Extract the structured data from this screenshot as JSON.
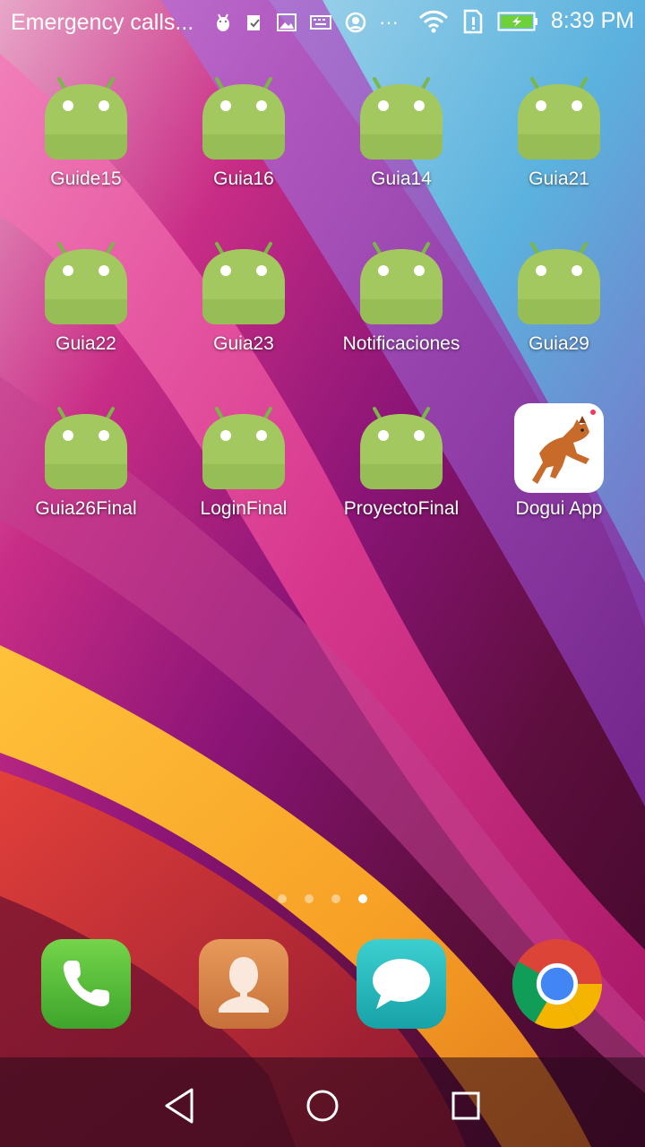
{
  "status_bar": {
    "carrier": "Emergency calls...",
    "time": "8:39 PM",
    "icons": [
      "android-debug-icon",
      "clipboard-check-icon",
      "gallery-icon",
      "keyboard-icon",
      "vpn-icon",
      "more-icon",
      "wifi-icon",
      "sim-alert-icon",
      "battery-charging-icon"
    ]
  },
  "apps": [
    {
      "label": "Guide15",
      "icon": "android-icon"
    },
    {
      "label": "Guia16",
      "icon": "android-icon"
    },
    {
      "label": "Guia14",
      "icon": "android-icon"
    },
    {
      "label": "Guia21",
      "icon": "android-icon"
    },
    {
      "label": "Guia22",
      "icon": "android-icon"
    },
    {
      "label": "Guia23",
      "icon": "android-icon"
    },
    {
      "label": "Notificaciones",
      "icon": "android-icon"
    },
    {
      "label": "Guia29",
      "icon": "android-icon"
    },
    {
      "label": "Guia26Final",
      "icon": "android-icon"
    },
    {
      "label": "LoginFinal",
      "icon": "android-icon"
    },
    {
      "label": "ProyectoFinal",
      "icon": "android-icon"
    },
    {
      "label": "Dogui App",
      "icon": "dog-icon"
    }
  ],
  "page_indicator": {
    "pages": 4,
    "current_page": 4
  },
  "dock": [
    {
      "name": "phone",
      "icon": "phone-icon",
      "color": "#4caf3a"
    },
    {
      "name": "contacts",
      "icon": "contacts-icon",
      "color": "#d9824a"
    },
    {
      "name": "messaging",
      "icon": "message-icon",
      "color": "#1fb3b9"
    },
    {
      "name": "chrome",
      "icon": "chrome-icon"
    }
  ],
  "nav_bar": [
    "back-icon",
    "home-icon",
    "recents-icon"
  ]
}
